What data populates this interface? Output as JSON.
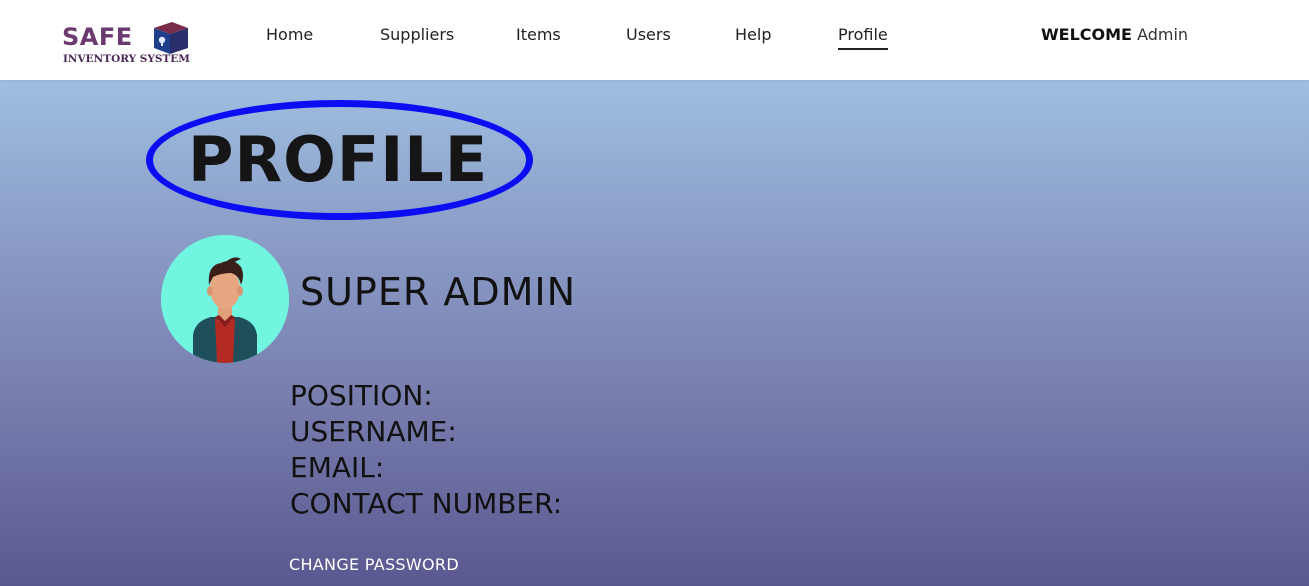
{
  "brand": {
    "name": "SAFE",
    "subtitle": "INVENTORY SYSTEM"
  },
  "nav": {
    "items": [
      {
        "label": "Home",
        "active": false
      },
      {
        "label": "Suppliers",
        "active": false
      },
      {
        "label": "Items",
        "active": false
      },
      {
        "label": "Users",
        "active": false
      },
      {
        "label": "Help",
        "active": false
      },
      {
        "label": "Profile",
        "active": true
      }
    ],
    "welcome_strong": "WELCOME",
    "welcome_user": "Admin"
  },
  "page": {
    "title": "PROFILE",
    "profile_name": "SUPER ADMIN",
    "fields": [
      "POSITION:",
      "USERNAME:",
      "EMAIL:",
      "CONTACT NUMBER:"
    ],
    "change_password": "CHANGE PASSWORD"
  },
  "colors": {
    "annotation": "#0b0ef5",
    "avatar_bg": "#72f5e0",
    "brand": "#6b3a6e"
  }
}
